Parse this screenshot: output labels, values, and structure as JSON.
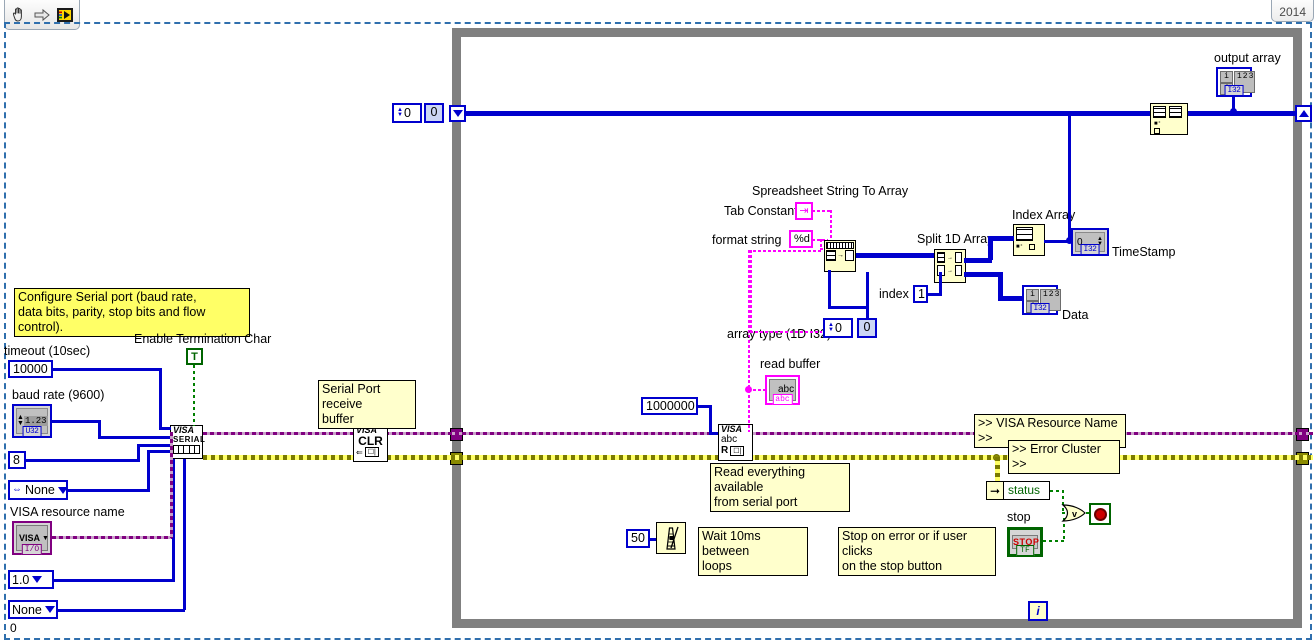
{
  "window": {
    "year_tab": "2014",
    "toolbar_icons": [
      "hand-cursor-icon",
      "arrow-cursor-icon",
      "labview-vi-icon"
    ]
  },
  "comments": {
    "configure_serial": "Configure Serial port (baud rate,\ndata bits, parity, stop bits and flow control).",
    "serial_receive_buffer": "Serial Port receive\nbuffer",
    "read_everything": "Read everything available\nfrom serial port",
    "wait_10ms": "Wait 10ms between\nloops",
    "stop_on_error": "Stop on error or if user clicks\non the stop button",
    "visa_resource_name_conn": ">> VISA Resource Name >>",
    "error_cluster_conn": ">> Error Cluster >>"
  },
  "labels": {
    "timeout": "timeout (10sec)",
    "baud_rate": "baud rate (9600)",
    "visa_resource_name": "VISA resource name",
    "enable_termination_char": "Enable Termination Char",
    "spreadsheet_string_to_array": "Spreadsheet String To Array",
    "tab_constant": "Tab Constant",
    "format_string": "format string",
    "array_type": "array type (1D I32)",
    "split_1d_array": "Split 1D Array",
    "index": "index",
    "index_array": "Index Array",
    "timestamp": "TimeStamp",
    "data": "Data",
    "output_array": "output array",
    "read_buffer": "read buffer",
    "status": "status",
    "stop": "stop"
  },
  "constants": {
    "timeout_value": "10000",
    "data_bits": "8",
    "parity": "None",
    "stop_bits": "1.0",
    "flow_control": "None",
    "flow_control_extra": "0",
    "baud_rate_ctrl": "1.23",
    "baud_rate_type": "U32",
    "visa_tag": "VISA",
    "visa_io_type": "I/O",
    "termination_char_bool": "T",
    "byte_count": "1000000",
    "wait_ms": "50",
    "format_string_value": "%d",
    "array_type_num": "0",
    "array_type_elem": "0",
    "split_index": "1",
    "loop_init_num": "0",
    "loop_init_elem": "0",
    "timestamp_value": "0",
    "numeric_display": "123",
    "i32_tag": "I32",
    "abc_tag": "abc",
    "read_buffer_text": "abc",
    "iteration_terminal": "i",
    "stop_button_label": "STOP",
    "stop_button_type": "TF",
    "or_gate_label": "V"
  },
  "nodes": {
    "visa_configure_serial": {
      "title": "VISA",
      "sub": "SERIAL"
    },
    "visa_clear": {
      "title": "VISA",
      "sub": "CLR"
    },
    "visa_read": {
      "title": "VISA",
      "sub": "abc",
      "marker": "R"
    }
  },
  "colors": {
    "numeric_wire": "#0000cd",
    "string_wire": "#ff00ff",
    "visa_wire": "#800080",
    "error_wire": "#b0b000",
    "boolean_wire": "#008000",
    "loop_border": "#808080",
    "comment_bg": "#ffffcc",
    "highlight_comment_bg": "#ffff66",
    "node_bg": "#ffffcc",
    "frame_dash": "#2f6fad"
  }
}
